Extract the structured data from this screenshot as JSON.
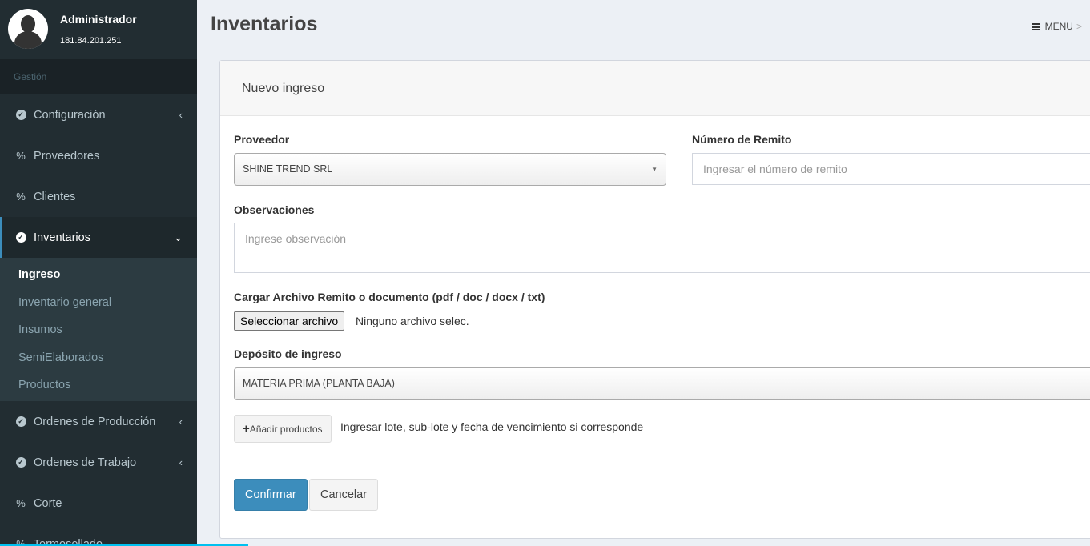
{
  "user": {
    "name": "Administrador",
    "ip": "181.84.201.251"
  },
  "sidebar": {
    "header": "Gestión",
    "items": [
      {
        "label": "Configuración",
        "icon": "check-circle",
        "chevron": "‹"
      },
      {
        "label": "Proveedores",
        "icon": "percent"
      },
      {
        "label": "Clientes",
        "icon": "percent"
      },
      {
        "label": "Inventarios",
        "icon": "check-circle",
        "chevron": "⌄"
      },
      {
        "label": "Ordenes de Producción",
        "icon": "check-circle",
        "chevron": "‹"
      },
      {
        "label": "Ordenes de Trabajo",
        "icon": "check-circle",
        "chevron": "‹"
      },
      {
        "label": "Corte",
        "icon": "percent"
      },
      {
        "label": "Termosellado",
        "icon": "percent"
      }
    ],
    "submenu": [
      "Ingreso",
      "Inventario general",
      "Insumos",
      "SemiElaborados",
      "Productos"
    ]
  },
  "header": {
    "title": "Inventarios",
    "menu_label": "MENU",
    "menu_chevron": ">"
  },
  "form": {
    "title": "Nuevo ingreso",
    "proveedor_label": "Proveedor",
    "proveedor_value": "SHINE TREND SRL",
    "remito_label": "Número de Remito",
    "remito_placeholder": "Ingresar el número de remito",
    "observaciones_label": "Observaciones",
    "observaciones_placeholder": "Ingrese observación",
    "archivo_label": "Cargar Archivo Remito o documento (pdf / doc / docx / txt)",
    "archivo_button": "Seleccionar archivo",
    "archivo_status": "Ninguno archivo selec.",
    "deposito_label": "Depósito de ingreso",
    "deposito_value": "MATERIA PRIMA (PLANTA BAJA)",
    "add_button": "Añadir productos",
    "add_hint": "Ingresar lote, sub-lote y fecha de vencimiento si corresponde",
    "confirm_button": "Confirmar",
    "cancel_button": "Cancelar"
  },
  "colors": {
    "sidebar_bg": "#222d32",
    "accent": "#3c8dbc",
    "page_bg": "#ecf0f5"
  }
}
